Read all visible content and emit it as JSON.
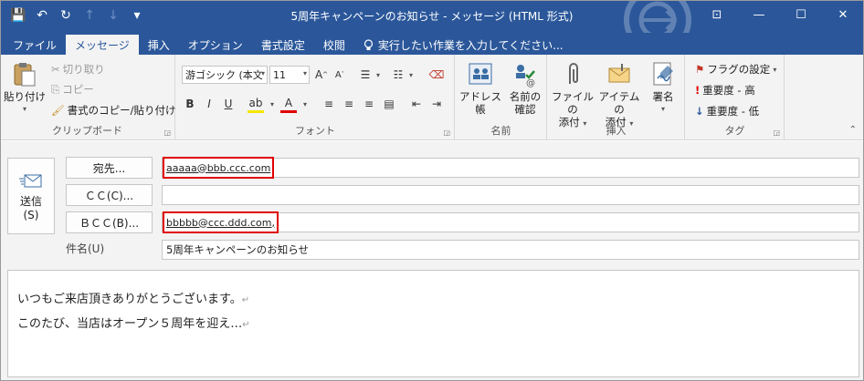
{
  "window": {
    "title": "5周年キャンペーンのお知らせ - メッセージ (HTML 形式)",
    "controls": {
      "ribbon_options": "⊡",
      "minimize": "—",
      "maximize": "☐",
      "close": "✕"
    }
  },
  "qat": {
    "save": "💾",
    "undo": "↶",
    "redo": "↻",
    "up": "↑",
    "down": "↓",
    "customize": "▾"
  },
  "tabs": [
    {
      "label": "ファイル"
    },
    {
      "label": "メッセージ"
    },
    {
      "label": "挿入"
    },
    {
      "label": "オプション"
    },
    {
      "label": "書式設定"
    },
    {
      "label": "校閲"
    }
  ],
  "tell_me": "実行したい作業を入力してください...",
  "ribbon": {
    "clipboard": {
      "paste": "貼り付け",
      "cut": "切り取り",
      "copy": "コピー",
      "format_painter": "書式のコピー/貼り付け",
      "label": "クリップボード"
    },
    "font": {
      "font_name": "游ゴシック (本文",
      "font_size": "11",
      "bold": "B",
      "italic": "I",
      "underline": "U",
      "label": "フォント"
    },
    "names": {
      "address_book": "アドレス帳",
      "check_names_1": "名前の",
      "check_names_2": "確認",
      "label": "名前"
    },
    "include": {
      "attach_file_1": "ファイルの",
      "attach_file_2": "添付",
      "attach_item_1": "アイテムの",
      "attach_item_2": "添付",
      "signature": "署名",
      "label": "挿入"
    },
    "tags": {
      "follow_up": "フラグの設定",
      "high_importance": "重要度 - 高",
      "low_importance": "重要度 - 低",
      "label": "タグ"
    }
  },
  "compose": {
    "send_1": "送信",
    "send_2": "(S)",
    "to_button": "宛先...",
    "cc_button": "ＣＣ(C)...",
    "bcc_button": "ＢＣＣ(B)...",
    "subject_label": "件名(U)",
    "to_value": "aaaaa@bbb.ccc.com",
    "cc_value": "",
    "bcc_value": "bbbbb@ccc.ddd.com,",
    "subject_value": "5周年キャンペーンのお知らせ",
    "body_lines": [
      "いつもご来店頂きありがとうございます。",
      "このたび、当店はオープン５周年を迎え…"
    ],
    "paragraph_mark": "↵"
  },
  "colors": {
    "title_bar": "#2b579a",
    "highlight_box": "#e00000"
  }
}
